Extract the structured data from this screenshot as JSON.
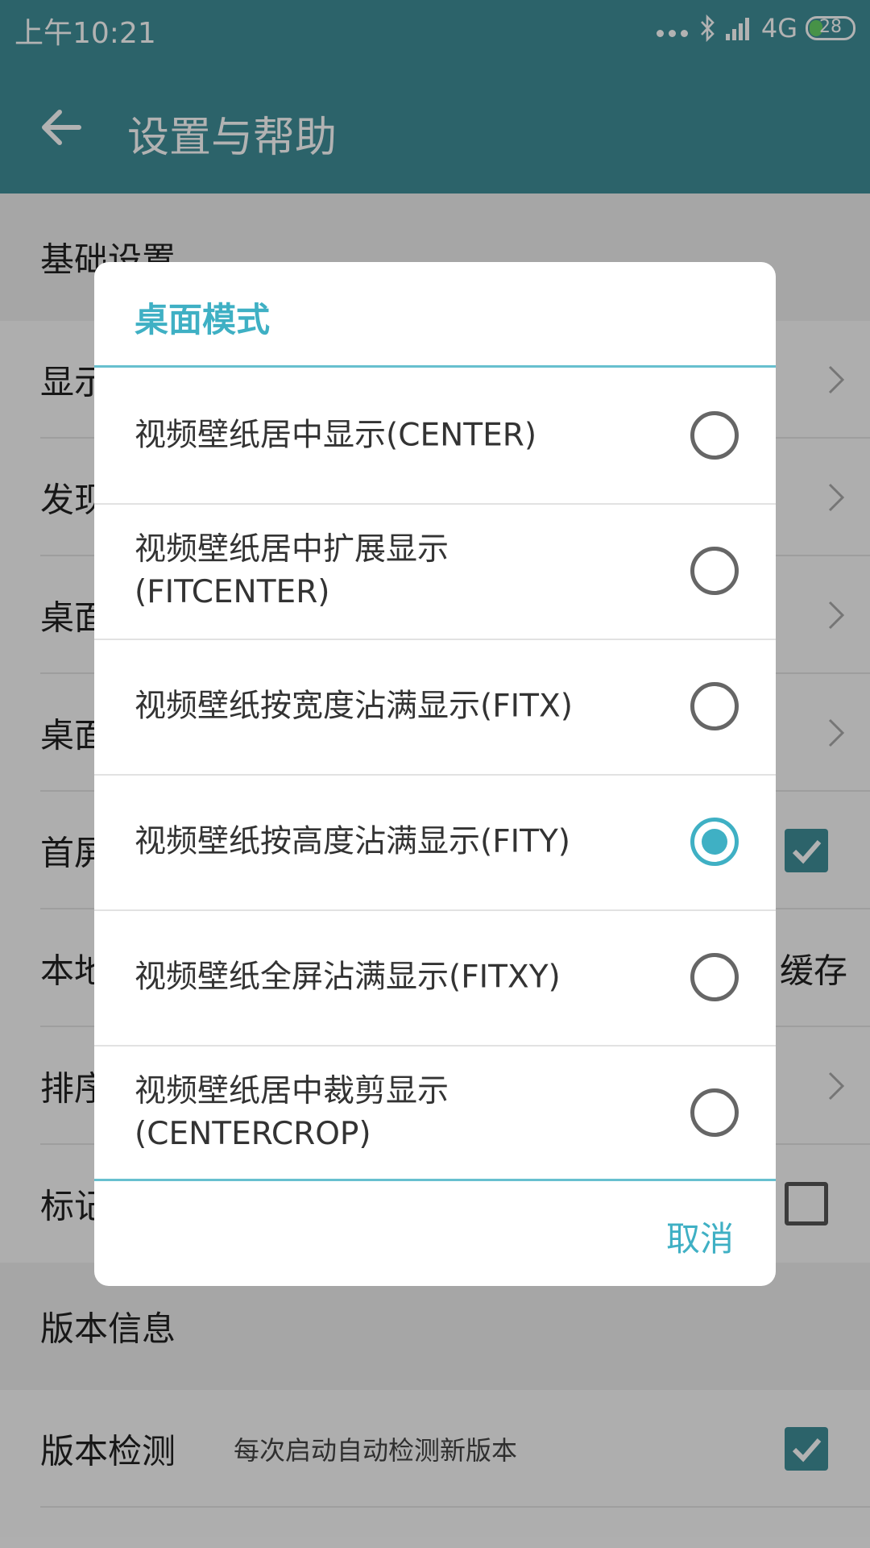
{
  "status_bar": {
    "time": "上午10:21",
    "network": "4G",
    "battery": "28"
  },
  "app_bar": {
    "title": "设置与帮助"
  },
  "settings": {
    "section_basic": "基础设置",
    "rows": [
      {
        "label": "显示"
      },
      {
        "label": "发现"
      },
      {
        "label": "桌面"
      },
      {
        "label": "桌面"
      },
      {
        "label": "首屏"
      },
      {
        "label": "本地",
        "extra": "缓存"
      },
      {
        "label": "排序"
      },
      {
        "label": "标记"
      }
    ],
    "section_version": "版本信息",
    "version_check": {
      "label": "版本检测",
      "desc": "每次启动自动检测新版本"
    }
  },
  "dialog": {
    "title": "桌面模式",
    "options": [
      {
        "label": "视频壁纸居中显示(CENTER)",
        "selected": false
      },
      {
        "label": "视频壁纸居中扩展显示\n(FITCENTER)",
        "selected": false
      },
      {
        "label": "视频壁纸按宽度沾满显示(FITX)",
        "selected": false
      },
      {
        "label": "视频壁纸按高度沾满显示(FITY)",
        "selected": true
      },
      {
        "label": "视频壁纸全屏沾满显示(FITXY)",
        "selected": false
      },
      {
        "label": "视频壁纸居中裁剪显示\n(CENTERCROP)",
        "selected": false
      }
    ],
    "cancel": "取消"
  },
  "colors": {
    "primary": "#3f8f99",
    "accent": "#3fb0c4"
  }
}
